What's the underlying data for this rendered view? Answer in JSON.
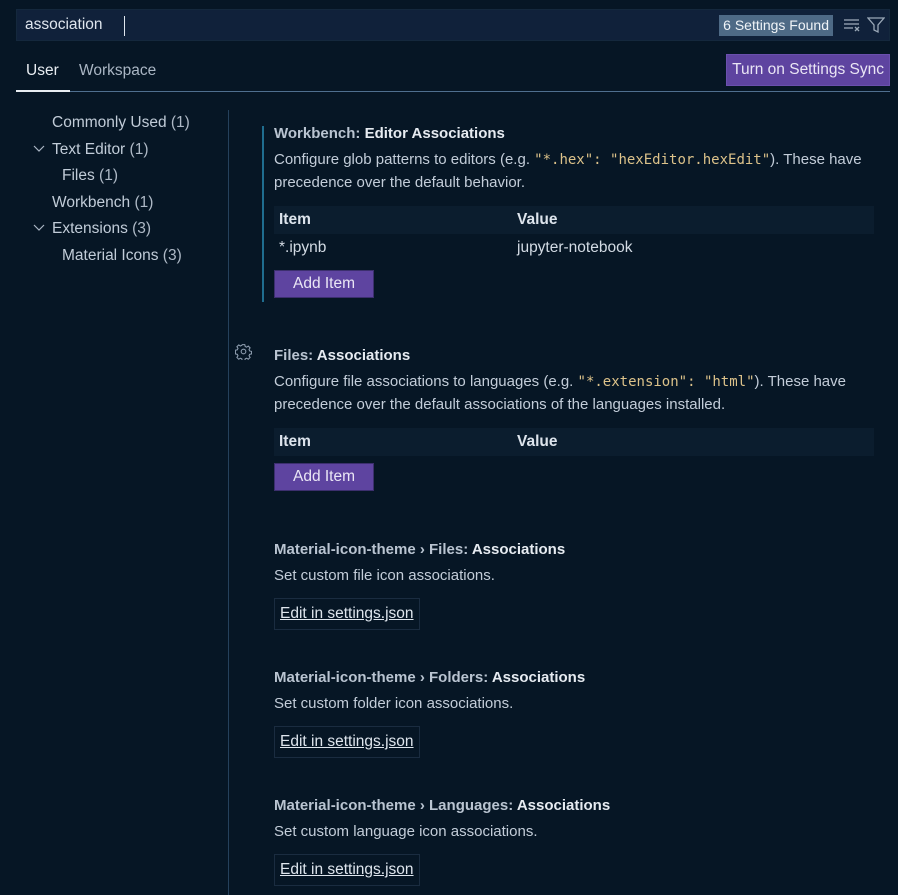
{
  "search": {
    "value": "association",
    "result_count": "6 Settings Found",
    "clear_icon": "clear-filter-icon",
    "filter_icon": "filter-icon"
  },
  "tabs": [
    {
      "label": "User",
      "active": true
    },
    {
      "label": "Workspace",
      "active": false
    }
  ],
  "sync_button": "Turn on Settings Sync",
  "toc": [
    {
      "label": "Commonly Used",
      "count": "(1)",
      "expandable": false,
      "level": 0
    },
    {
      "label": "Text Editor",
      "count": "(1)",
      "expandable": true,
      "level": 0
    },
    {
      "label": "Files",
      "count": "(1)",
      "expandable": false,
      "level": 1
    },
    {
      "label": "Workbench",
      "count": "(1)",
      "expandable": false,
      "level": 0
    },
    {
      "label": "Extensions",
      "count": "(3)",
      "expandable": true,
      "level": 0
    },
    {
      "label": "Material Icons",
      "count": "(3)",
      "expandable": false,
      "level": 1
    }
  ],
  "settings": [
    {
      "category": "Workbench: ",
      "key": "Editor Associations",
      "desc_pre": "Configure glob patterns to editors (e.g. ",
      "desc_code": "\"*.hex\": \"hexEditor.hexEdit\"",
      "desc_post": "). These have precedence over the default behavior.",
      "table_headers": [
        "Item",
        "Value"
      ],
      "rows": [
        {
          "item": "*.ipynb",
          "value": "jupyter-notebook"
        }
      ],
      "button": "Add Item"
    },
    {
      "category": "Files: ",
      "key": "Associations",
      "desc_pre": "Configure file associations to languages (e.g. ",
      "desc_code": "\"*.extension\": \"html\"",
      "desc_post": "). These have precedence over the default associations of the languages installed.",
      "table_headers": [
        "Item",
        "Value"
      ],
      "rows": [],
      "button": "Add Item"
    },
    {
      "category": "Material-icon-theme › Files: ",
      "key": "Associations",
      "desc": "Set custom file icon associations.",
      "link": "Edit in settings.json"
    },
    {
      "category": "Material-icon-theme › Folders: ",
      "key": "Associations",
      "desc": "Set custom folder icon associations.",
      "link": "Edit in settings.json"
    },
    {
      "category": "Material-icon-theme › Languages: ",
      "key": "Associations",
      "desc": "Set custom language icon associations.",
      "link": "Edit in settings.json"
    }
  ],
  "colors": {
    "background": "#061625",
    "accent_button": "#5e44a0",
    "focus_bar": "#1f6d8f",
    "badge": "#4e6a86",
    "code": "#dcc28a"
  }
}
